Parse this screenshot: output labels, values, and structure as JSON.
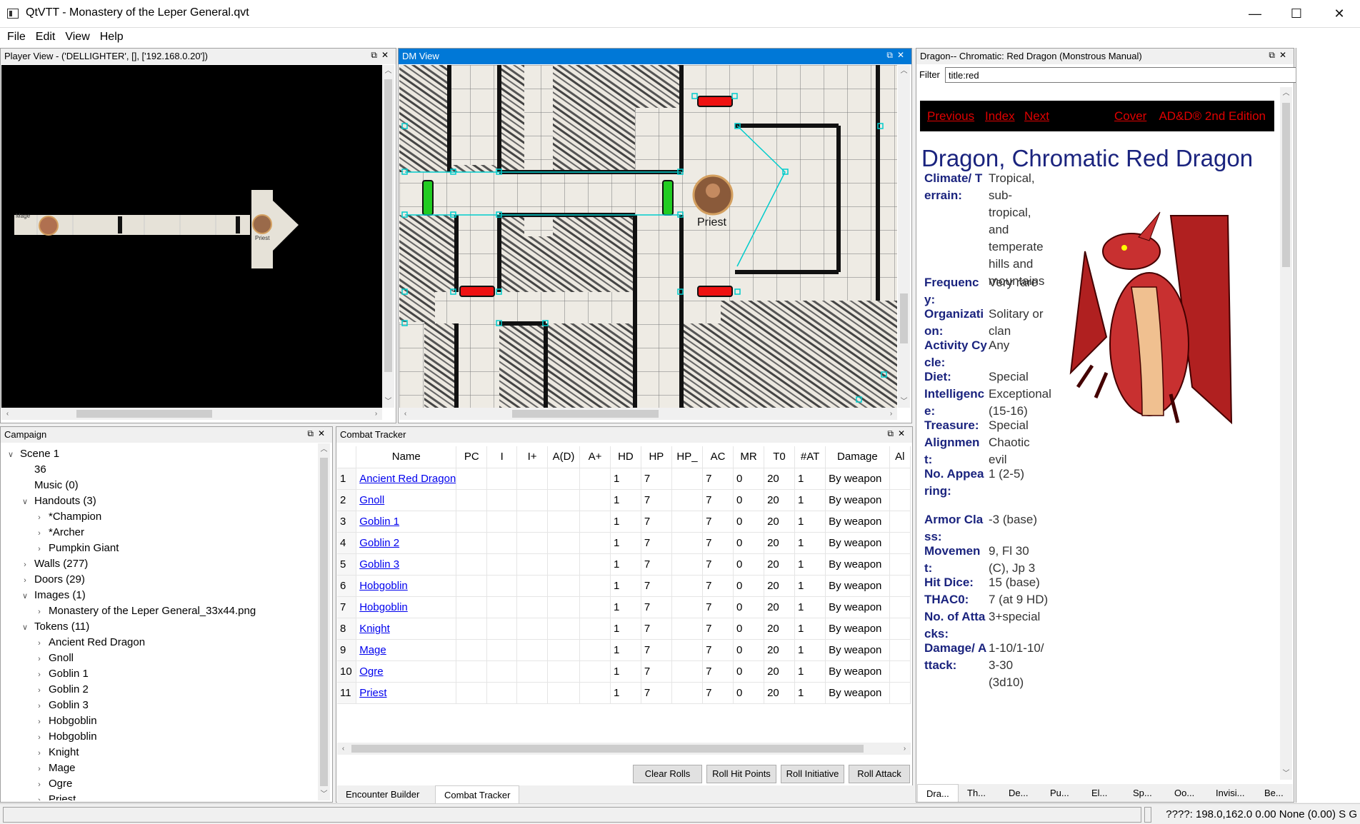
{
  "window": {
    "title": "QtVTT - Monastery of the Leper General.qvt",
    "minimize": "—",
    "maximize": "☐",
    "close": "✕"
  },
  "menu": [
    "File",
    "Edit",
    "View",
    "Help"
  ],
  "player_view": {
    "title": "Player View - ('DELLIGHTER', [], ['192.168.0.20'])",
    "tokens": [
      "Mage",
      "Priest"
    ]
  },
  "dm_view": {
    "title": "DM View",
    "token_label": "Priest"
  },
  "monster_panel": {
    "title": "Dragon-- Chromatic: Red Dragon (Monstrous Manual)",
    "filter_label": "Filter",
    "filter_value": "title:red",
    "nav": [
      "Previous",
      "Index",
      "Next",
      "Cover"
    ],
    "edition": "AD&D® 2nd Edition",
    "heading": "Dragon, Chromatic Red Dragon",
    "stats": [
      {
        "k": "Climate/ Terrain:",
        "v": "Tropical, sub-tropical, and temperate hills and mountains"
      },
      {
        "k": "Frequency:",
        "v": "Very rare"
      },
      {
        "k": "Organization:",
        "v": "Solitary or clan"
      },
      {
        "k": "Activity Cycle:",
        "v": "Any"
      },
      {
        "k": "Diet:",
        "v": "Special"
      },
      {
        "k": "Intelligence:",
        "v": "Exceptional (15-16)"
      },
      {
        "k": "Treasure:",
        "v": "Special"
      },
      {
        "k": "Alignment:",
        "v": "Chaotic evil"
      },
      {
        "k": "No. Appearing:",
        "v": "1 (2-5)"
      },
      {
        "k": "Armor Class:",
        "v": "-3 (base)"
      },
      {
        "k": "Movement:",
        "v": "9, Fl 30 (C), Jp 3"
      },
      {
        "k": "Hit Dice:",
        "v": "15 (base)"
      },
      {
        "k": "THAC0:",
        "v": "7 (at 9 HD)"
      },
      {
        "k": "No. of Attacks:",
        "v": "3+special"
      },
      {
        "k": "Damage/ Attack:",
        "v": "1-10/1-10/ 3-30 (3d10)"
      }
    ],
    "tabs": [
      "Dra...",
      "Th...",
      "De...",
      "Pu...",
      "El...",
      "Sp...",
      "Oo...",
      "Invisi...",
      "Be..."
    ]
  },
  "campaign": {
    "title": "Campaign",
    "tree": [
      {
        "label": "Scene 1",
        "depth": 0,
        "tw": "∨"
      },
      {
        "label": "36",
        "depth": 1,
        "tw": ""
      },
      {
        "label": "Music (0)",
        "depth": 1,
        "tw": ""
      },
      {
        "label": "Handouts (3)",
        "depth": 1,
        "tw": "∨"
      },
      {
        "label": "*Champion",
        "depth": 2,
        "tw": "›"
      },
      {
        "label": "*Archer",
        "depth": 2,
        "tw": "›"
      },
      {
        "label": "Pumpkin Giant",
        "depth": 2,
        "tw": "›"
      },
      {
        "label": "Walls (277)",
        "depth": 1,
        "tw": "›"
      },
      {
        "label": "Doors (29)",
        "depth": 1,
        "tw": "›"
      },
      {
        "label": "Images (1)",
        "depth": 1,
        "tw": "∨"
      },
      {
        "label": "Monastery of the Leper General_33x44.png",
        "depth": 2,
        "tw": "›"
      },
      {
        "label": "Tokens (11)",
        "depth": 1,
        "tw": "∨"
      },
      {
        "label": "Ancient Red Dragon",
        "depth": 2,
        "tw": "›"
      },
      {
        "label": "Gnoll",
        "depth": 2,
        "tw": "›"
      },
      {
        "label": "Goblin 1",
        "depth": 2,
        "tw": "›"
      },
      {
        "label": "Goblin 2",
        "depth": 2,
        "tw": "›"
      },
      {
        "label": "Goblin 3",
        "depth": 2,
        "tw": "›"
      },
      {
        "label": "Hobgoblin",
        "depth": 2,
        "tw": "›"
      },
      {
        "label": "Hobgoblin",
        "depth": 2,
        "tw": "›"
      },
      {
        "label": "Knight",
        "depth": 2,
        "tw": "›"
      },
      {
        "label": "Mage",
        "depth": 2,
        "tw": "›"
      },
      {
        "label": "Ogre",
        "depth": 2,
        "tw": "›"
      },
      {
        "label": "Priest",
        "depth": 2,
        "tw": "›"
      }
    ]
  },
  "combat": {
    "title": "Combat Tracker",
    "columns": [
      "",
      "Name",
      "PC",
      "I",
      "I+",
      "A(D)",
      "A+",
      "HD",
      "HP",
      "HP_",
      "AC",
      "MR",
      "T0",
      "#AT",
      "Damage",
      "Al"
    ],
    "rows": [
      [
        "1",
        "Ancient Red Dragon",
        "",
        "",
        "",
        "",
        "",
        "1",
        "7",
        "",
        "7",
        "0",
        "20",
        "1",
        "By weapon",
        ""
      ],
      [
        "2",
        "Gnoll",
        "",
        "",
        "",
        "",
        "",
        "1",
        "7",
        "",
        "7",
        "0",
        "20",
        "1",
        "By weapon",
        ""
      ],
      [
        "3",
        "Goblin 1",
        "",
        "",
        "",
        "",
        "",
        "1",
        "7",
        "",
        "7",
        "0",
        "20",
        "1",
        "By weapon",
        ""
      ],
      [
        "4",
        "Goblin 2",
        "",
        "",
        "",
        "",
        "",
        "1",
        "7",
        "",
        "7",
        "0",
        "20",
        "1",
        "By weapon",
        ""
      ],
      [
        "5",
        "Goblin 3",
        "",
        "",
        "",
        "",
        "",
        "1",
        "7",
        "",
        "7",
        "0",
        "20",
        "1",
        "By weapon",
        ""
      ],
      [
        "6",
        "Hobgoblin",
        "",
        "",
        "",
        "",
        "",
        "1",
        "7",
        "",
        "7",
        "0",
        "20",
        "1",
        "By weapon",
        ""
      ],
      [
        "7",
        "Hobgoblin",
        "",
        "",
        "",
        "",
        "",
        "1",
        "7",
        "",
        "7",
        "0",
        "20",
        "1",
        "By weapon",
        ""
      ],
      [
        "8",
        "Knight",
        "",
        "",
        "",
        "",
        "",
        "1",
        "7",
        "",
        "7",
        "0",
        "20",
        "1",
        "By weapon",
        ""
      ],
      [
        "9",
        "Mage",
        "",
        "",
        "",
        "",
        "",
        "1",
        "7",
        "",
        "7",
        "0",
        "20",
        "1",
        "By weapon",
        ""
      ],
      [
        "10",
        "Ogre",
        "",
        "",
        "",
        "",
        "",
        "1",
        "7",
        "",
        "7",
        "0",
        "20",
        "1",
        "By weapon",
        ""
      ],
      [
        "11",
        "Priest",
        "",
        "",
        "",
        "",
        "",
        "1",
        "7",
        "",
        "7",
        "0",
        "20",
        "1",
        "By weapon",
        ""
      ]
    ],
    "buttons": [
      "Clear Rolls",
      "Roll Hit Points",
      "Roll Initiative",
      "Roll Attack"
    ],
    "tabs": [
      "Encounter Builder",
      "Combat Tracker"
    ]
  },
  "status": {
    "text": "????: 198.0,162.0 0.00 None (0.00) S G"
  },
  "colors": {
    "accent": "#0078d7",
    "door_open": "#22cc22",
    "door_closed": "#ee1111",
    "wall_handle": "#00cccc",
    "mm_heading": "#1a237e",
    "mm_nav": "#e00000"
  }
}
